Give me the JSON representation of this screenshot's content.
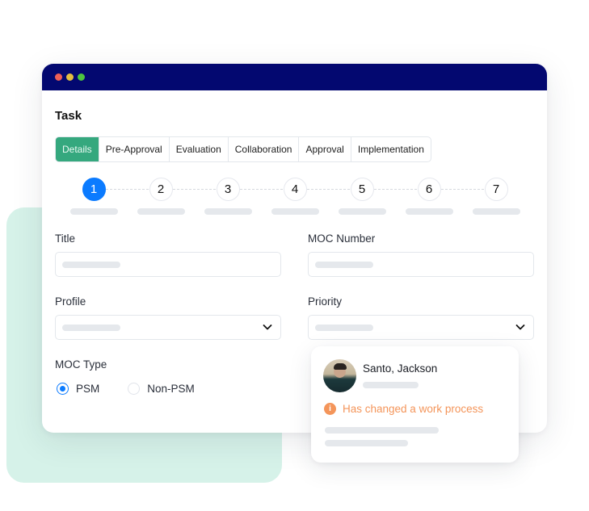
{
  "window": {
    "controls": [
      "close",
      "minimize",
      "maximize"
    ],
    "titlebar_color": "#030870"
  },
  "task": {
    "title": "Task"
  },
  "tabs": [
    {
      "label": "Details",
      "active": true
    },
    {
      "label": "Pre-Approval",
      "active": false
    },
    {
      "label": "Evaluation",
      "active": false
    },
    {
      "label": "Collaboration",
      "active": false
    },
    {
      "label": "Approval",
      "active": false
    },
    {
      "label": "Implementation",
      "active": false
    }
  ],
  "stepper": {
    "current_step": 1,
    "steps": [
      "1",
      "2",
      "3",
      "4",
      "5",
      "6",
      "7"
    ]
  },
  "form": {
    "title": {
      "label": "Title",
      "value": ""
    },
    "moc_number": {
      "label": "MOC Number",
      "value": ""
    },
    "profile": {
      "label": "Profile",
      "value": ""
    },
    "priority": {
      "label": "Priority",
      "value": ""
    },
    "moc_type": {
      "label": "MOC Type",
      "options": [
        {
          "label": "PSM",
          "checked": true
        },
        {
          "label": "Non-PSM",
          "checked": false
        }
      ]
    }
  },
  "notification": {
    "name": "Santo, Jackson",
    "message": "Has changed a work process",
    "icon": "info-icon",
    "accent_color": "#f4955a"
  },
  "colors": {
    "active_tab": "#35a87e",
    "active_step": "#0b7bff",
    "background_accent": "#d6f2e9"
  }
}
